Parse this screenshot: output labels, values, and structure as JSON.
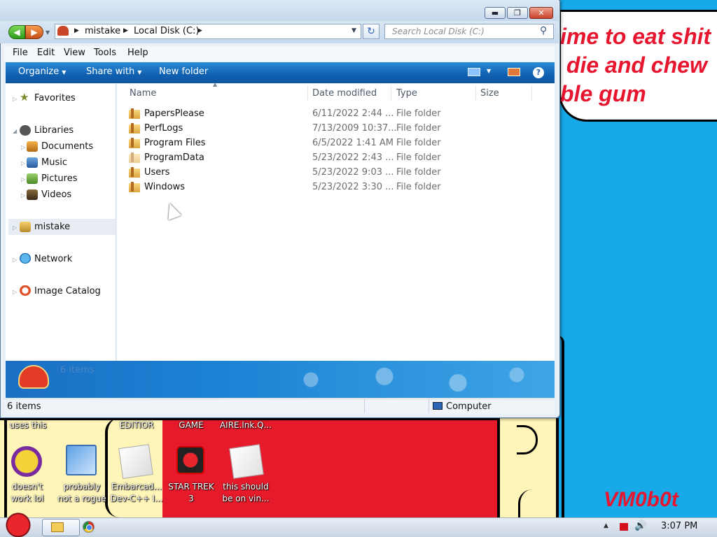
{
  "window": {
    "controls": {
      "minimize": "▬",
      "maximize": "❐",
      "close": "✕"
    },
    "address": {
      "crumbs": [
        "mistake",
        "Local Disk (C:)"
      ]
    },
    "search": {
      "placeholder": "Search Local Disk (C:)"
    },
    "menu": [
      "File",
      "Edit",
      "View",
      "Tools",
      "Help"
    ],
    "toolbar": {
      "organize": "Organize",
      "share": "Share with",
      "new_folder": "New folder",
      "help": "?"
    },
    "nav": {
      "favorites": "Favorites",
      "libraries": "Libraries",
      "documents": "Documents",
      "music": "Music",
      "pictures": "Pictures",
      "videos": "Videos",
      "homegroup": "mistake",
      "network": "Network",
      "image_catalog": "Image Catalog"
    },
    "columns": {
      "name": "Name",
      "date": "Date modified",
      "type": "Type",
      "size": "Size"
    },
    "files": [
      {
        "name": "PapersPlease",
        "date": "6/11/2022 2:44 ...",
        "type": "File folder"
      },
      {
        "name": "PerfLogs",
        "date": "7/13/2009 10:37...",
        "type": "File folder"
      },
      {
        "name": "Program Files",
        "date": "6/5/2022 1:41 AM",
        "type": "File folder"
      },
      {
        "name": "ProgramData",
        "date": "5/23/2022 2:43 ...",
        "type": "File folder"
      },
      {
        "name": "Users",
        "date": "5/23/2022 9:03 ...",
        "type": "File folder"
      },
      {
        "name": "Windows",
        "date": "5/23/2022 3:30 ...",
        "type": "File folder"
      }
    ],
    "details": {
      "count": "6 items"
    },
    "status": {
      "left": "6 items",
      "right": "Computer"
    }
  },
  "desktop": {
    "speech_text": "ime to eat shit\n die and chew\nble gum",
    "signature": "VM0b0t",
    "icons": {
      "top_label_1": "uses this",
      "top_label_2": "EDITIOR",
      "top_label_3": "GAME",
      "top_label_4": "AIRE.lnk.Q...",
      "yahoo": "doesn't\nwork lol",
      "probably": "probably\nnot a rogue",
      "embarcadero": "Embarcad...\nDev-C++ I...",
      "startrek": "STAR TREK\n3",
      "vin": "this should\nbe on vin..."
    }
  },
  "taskbar": {
    "clock": "3:07 PM"
  },
  "colors": {
    "wallpaper": "#17a9e8",
    "accent_red": "#e8152f",
    "toolbar_blue": "#1060b0"
  }
}
